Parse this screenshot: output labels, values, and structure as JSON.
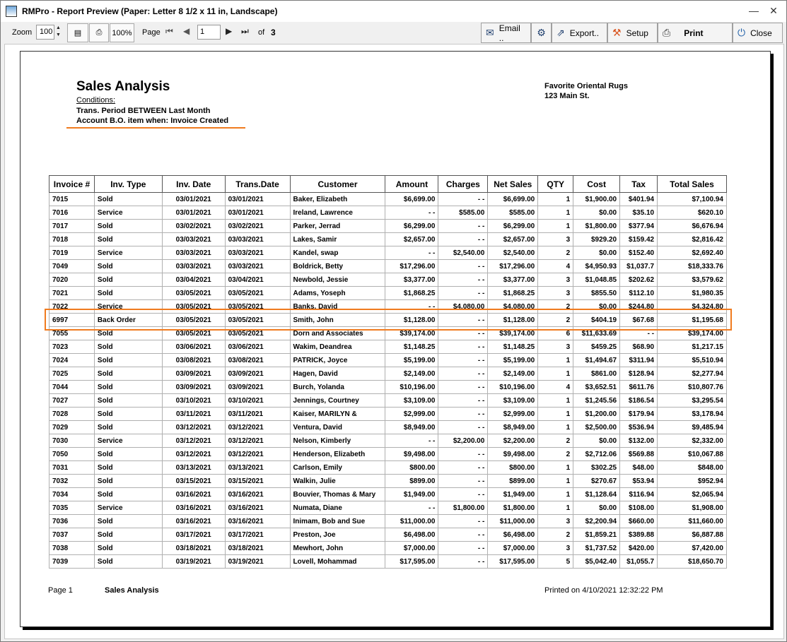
{
  "window": {
    "title": "RMPro - Report Preview (Paper: Letter 8 1/2 x 11 in, Landscape)",
    "minimize": "—",
    "maximize": "☐",
    "close": "✕"
  },
  "toolbar": {
    "zoom_label": "Zoom",
    "zoom_value": "100",
    "zoom_100_label": "100%",
    "page_label": "Page",
    "page_value": "1",
    "of_label": "of",
    "page_total": "3",
    "email_label": "Email ..",
    "export_label": "Export..",
    "setup_label": "Setup",
    "print_label": "Print",
    "close_label": "Close"
  },
  "report": {
    "title": "Sales Analysis",
    "conditions_label": "Conditions:",
    "condition_1": "Trans. Period  BETWEEN  Last Month",
    "condition_2": "Account B.O. item when:  Invoice Created",
    "company_name": "Favorite Oriental Rugs",
    "company_address": "123 Main St.",
    "columns": [
      "Invoice #",
      "Inv. Type",
      "Inv. Date",
      "Trans.Date",
      "Customer",
      "Amount",
      "Charges",
      "Net Sales",
      "QTY",
      "Cost",
      "Tax",
      "Total Sales"
    ],
    "rows": [
      [
        "7015",
        "Sold",
        "03/01/2021",
        "03/01/2021",
        "Baker, Elizabeth",
        "$6,699.00",
        "- -",
        "$6,699.00",
        "1",
        "$1,900.00",
        "$401.94",
        "$7,100.94"
      ],
      [
        "7016",
        "Service",
        "03/01/2021",
        "03/01/2021",
        "Ireland, Lawrence",
        "- -",
        "$585.00",
        "$585.00",
        "1",
        "$0.00",
        "$35.10",
        "$620.10"
      ],
      [
        "7017",
        "Sold",
        "03/02/2021",
        "03/02/2021",
        "Parker, Jerrad",
        "$6,299.00",
        "- -",
        "$6,299.00",
        "1",
        "$1,800.00",
        "$377.94",
        "$6,676.94"
      ],
      [
        "7018",
        "Sold",
        "03/03/2021",
        "03/03/2021",
        "Lakes, Samir",
        "$2,657.00",
        "- -",
        "$2,657.00",
        "3",
        "$929.20",
        "$159.42",
        "$2,816.42"
      ],
      [
        "7019",
        "Service",
        "03/03/2021",
        "03/03/2021",
        "Kandel, swap",
        "- -",
        "$2,540.00",
        "$2,540.00",
        "2",
        "$0.00",
        "$152.40",
        "$2,692.40"
      ],
      [
        "7049",
        "Sold",
        "03/03/2021",
        "03/03/2021",
        "Boldrick, Betty",
        "$17,296.00",
        "- -",
        "$17,296.00",
        "4",
        "$4,950.93",
        "$1,037.7",
        "$18,333.76"
      ],
      [
        "7020",
        "Sold",
        "03/04/2021",
        "03/04/2021",
        "Newbold, Jessie",
        "$3,377.00",
        "- -",
        "$3,377.00",
        "3",
        "$1,048.85",
        "$202.62",
        "$3,579.62"
      ],
      [
        "7021",
        "Sold",
        "03/05/2021",
        "03/05/2021",
        "Adams, Yoseph",
        "$1,868.25",
        "- -",
        "$1,868.25",
        "3",
        "$855.50",
        "$112.10",
        "$1,980.35"
      ],
      [
        "7022",
        "Service",
        "03/05/2021",
        "03/05/2021",
        "Banks, David",
        "- -",
        "$4,080.00",
        "$4,080.00",
        "2",
        "$0.00",
        "$244.80",
        "$4,324.80"
      ],
      [
        "6997",
        "Back Order",
        "03/05/2021",
        "03/05/2021",
        "Smith, John",
        "$1,128.00",
        "- -",
        "$1,128.00",
        "2",
        "$404.19",
        "$67.68",
        "$1,195.68"
      ],
      [
        "7055",
        "Sold",
        "03/05/2021",
        "03/05/2021",
        "Dorn and Associates",
        "$39,174.00",
        "- -",
        "$39,174.00",
        "6",
        "$11,633.69",
        "- -",
        "$39,174.00"
      ],
      [
        "7023",
        "Sold",
        "03/06/2021",
        "03/06/2021",
        "Wakim, Deandrea",
        "$1,148.25",
        "- -",
        "$1,148.25",
        "3",
        "$459.25",
        "$68.90",
        "$1,217.15"
      ],
      [
        "7024",
        "Sold",
        "03/08/2021",
        "03/08/2021",
        "PATRICK, Joyce",
        "$5,199.00",
        "- -",
        "$5,199.00",
        "1",
        "$1,494.67",
        "$311.94",
        "$5,510.94"
      ],
      [
        "7025",
        "Sold",
        "03/09/2021",
        "03/09/2021",
        "Hagen, David",
        "$2,149.00",
        "- -",
        "$2,149.00",
        "1",
        "$861.00",
        "$128.94",
        "$2,277.94"
      ],
      [
        "7044",
        "Sold",
        "03/09/2021",
        "03/09/2021",
        "Burch, Yolanda",
        "$10,196.00",
        "- -",
        "$10,196.00",
        "4",
        "$3,652.51",
        "$611.76",
        "$10,807.76"
      ],
      [
        "7027",
        "Sold",
        "03/10/2021",
        "03/10/2021",
        "Jennings, Courtney",
        "$3,109.00",
        "- -",
        "$3,109.00",
        "1",
        "$1,245.56",
        "$186.54",
        "$3,295.54"
      ],
      [
        "7028",
        "Sold",
        "03/11/2021",
        "03/11/2021",
        "Kaiser, MARILYN &",
        "$2,999.00",
        "- -",
        "$2,999.00",
        "1",
        "$1,200.00",
        "$179.94",
        "$3,178.94"
      ],
      [
        "7029",
        "Sold",
        "03/12/2021",
        "03/12/2021",
        "Ventura, David",
        "$8,949.00",
        "- -",
        "$8,949.00",
        "1",
        "$2,500.00",
        "$536.94",
        "$9,485.94"
      ],
      [
        "7030",
        "Service",
        "03/12/2021",
        "03/12/2021",
        "Nelson, Kimberly",
        "- -",
        "$2,200.00",
        "$2,200.00",
        "2",
        "$0.00",
        "$132.00",
        "$2,332.00"
      ],
      [
        "7050",
        "Sold",
        "03/12/2021",
        "03/12/2021",
        "Henderson, Elizabeth",
        "$9,498.00",
        "- -",
        "$9,498.00",
        "2",
        "$2,712.06",
        "$569.88",
        "$10,067.88"
      ],
      [
        "7031",
        "Sold",
        "03/13/2021",
        "03/13/2021",
        "Carlson, Emily",
        "$800.00",
        "- -",
        "$800.00",
        "1",
        "$302.25",
        "$48.00",
        "$848.00"
      ],
      [
        "7032",
        "Sold",
        "03/15/2021",
        "03/15/2021",
        "Walkin, Julie",
        "$899.00",
        "- -",
        "$899.00",
        "1",
        "$270.67",
        "$53.94",
        "$952.94"
      ],
      [
        "7034",
        "Sold",
        "03/16/2021",
        "03/16/2021",
        "Bouvier, Thomas & Mary",
        "$1,949.00",
        "- -",
        "$1,949.00",
        "1",
        "$1,128.64",
        "$116.94",
        "$2,065.94"
      ],
      [
        "7035",
        "Service",
        "03/16/2021",
        "03/16/2021",
        "Numata, Diane",
        "- -",
        "$1,800.00",
        "$1,800.00",
        "1",
        "$0.00",
        "$108.00",
        "$1,908.00"
      ],
      [
        "7036",
        "Sold",
        "03/16/2021",
        "03/16/2021",
        "Inimam, Bob and Sue",
        "$11,000.00",
        "- -",
        "$11,000.00",
        "3",
        "$2,200.94",
        "$660.00",
        "$11,660.00"
      ],
      [
        "7037",
        "Sold",
        "03/17/2021",
        "03/17/2021",
        "Preston, Joe",
        "$6,498.00",
        "- -",
        "$6,498.00",
        "2",
        "$1,859.21",
        "$389.88",
        "$6,887.88"
      ],
      [
        "7038",
        "Sold",
        "03/18/2021",
        "03/18/2021",
        "Mewhort, John",
        "$7,000.00",
        "- -",
        "$7,000.00",
        "3",
        "$1,737.52",
        "$420.00",
        "$7,420.00"
      ],
      [
        "7039",
        "Sold",
        "03/19/2021",
        "03/19/2021",
        "Lovell, Mohammad",
        "$17,595.00",
        "- -",
        "$17,595.00",
        "5",
        "$5,042.40",
        "$1,055.7",
        "$18,650.70"
      ]
    ],
    "footer_page": "Page 1",
    "footer_title": "Sales Analysis",
    "footer_printed": "Printed on 4/10/2021 12:32:22 PM"
  },
  "colors": {
    "highlight": "#f07b1f"
  }
}
